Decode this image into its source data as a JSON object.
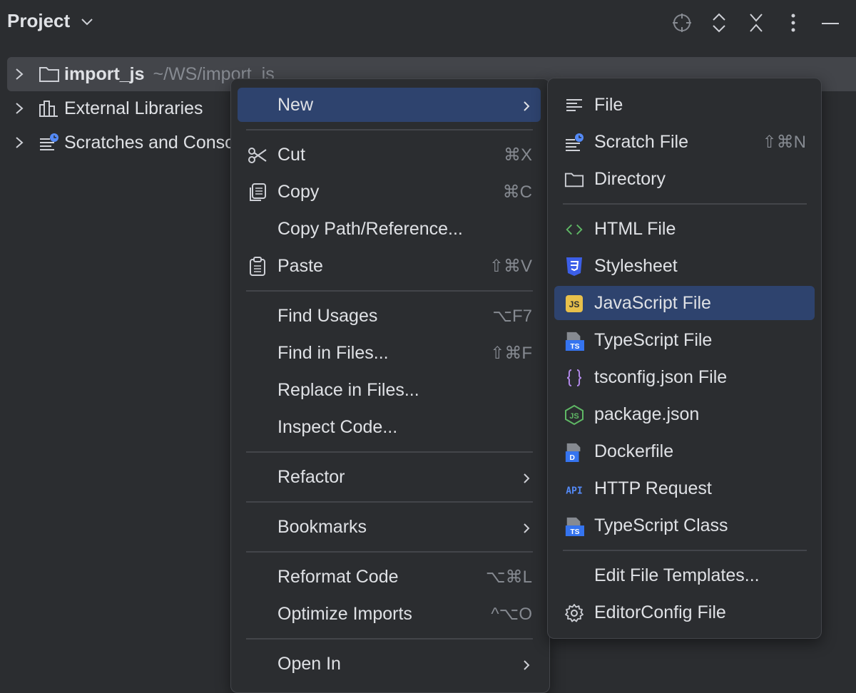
{
  "header": {
    "title": "Project"
  },
  "tree": [
    {
      "name": "import_js",
      "path": "~/WS/import_js"
    },
    {
      "name": "External Libraries"
    },
    {
      "name": "Scratches and Consoles"
    }
  ],
  "context_menu": {
    "new": "New",
    "cut": {
      "label": "Cut",
      "shortcut": "⌘X"
    },
    "copy": {
      "label": "Copy",
      "shortcut": "⌘C"
    },
    "copy_path": {
      "label": "Copy Path/Reference..."
    },
    "paste": {
      "label": "Paste",
      "shortcut": "⇧⌘V"
    },
    "find_usages": {
      "label": "Find Usages",
      "shortcut": "⌥F7"
    },
    "find_in_files": {
      "label": "Find in Files...",
      "shortcut": "⇧⌘F"
    },
    "replace_in_files": {
      "label": "Replace in Files..."
    },
    "inspect_code": {
      "label": "Inspect Code..."
    },
    "refactor": "Refactor",
    "bookmarks": "Bookmarks",
    "reformat_code": {
      "label": "Reformat Code",
      "shortcut": "⌥⌘L"
    },
    "optimize_imports": {
      "label": "Optimize Imports",
      "shortcut": "^⌥O"
    },
    "open_in": "Open In"
  },
  "new_submenu": {
    "file": "File",
    "scratch_file": {
      "label": "Scratch File",
      "shortcut": "⇧⌘N"
    },
    "directory": "Directory",
    "html_file": "HTML File",
    "stylesheet": "Stylesheet",
    "javascript_file": "JavaScript File",
    "typescript_file": "TypeScript File",
    "tsconfig_file": "tsconfig.json File",
    "package_json": "package.json",
    "dockerfile": "Dockerfile",
    "http_request": "HTTP Request",
    "typescript_class": "TypeScript Class",
    "edit_file_templates": "Edit File Templates...",
    "editorconfig_file": "EditorConfig File"
  },
  "icons": {
    "js_badge": "JS",
    "ts_badge": "TS",
    "docker_badge": "D",
    "api_badge": "API"
  },
  "colors": {
    "background": "#2b2d30",
    "selection": "#2e436e",
    "tree_selection": "#43454a",
    "text": "#dfe1e5",
    "muted": "#868a91",
    "html_green": "#5fb865",
    "css_blue": "#3c5fe8",
    "js_yellow": "#e8c04b",
    "json_purple": "#b188e8",
    "node_green": "#5fb865",
    "api_blue": "#548af7",
    "scratch_badge_blue": "#548af7"
  }
}
